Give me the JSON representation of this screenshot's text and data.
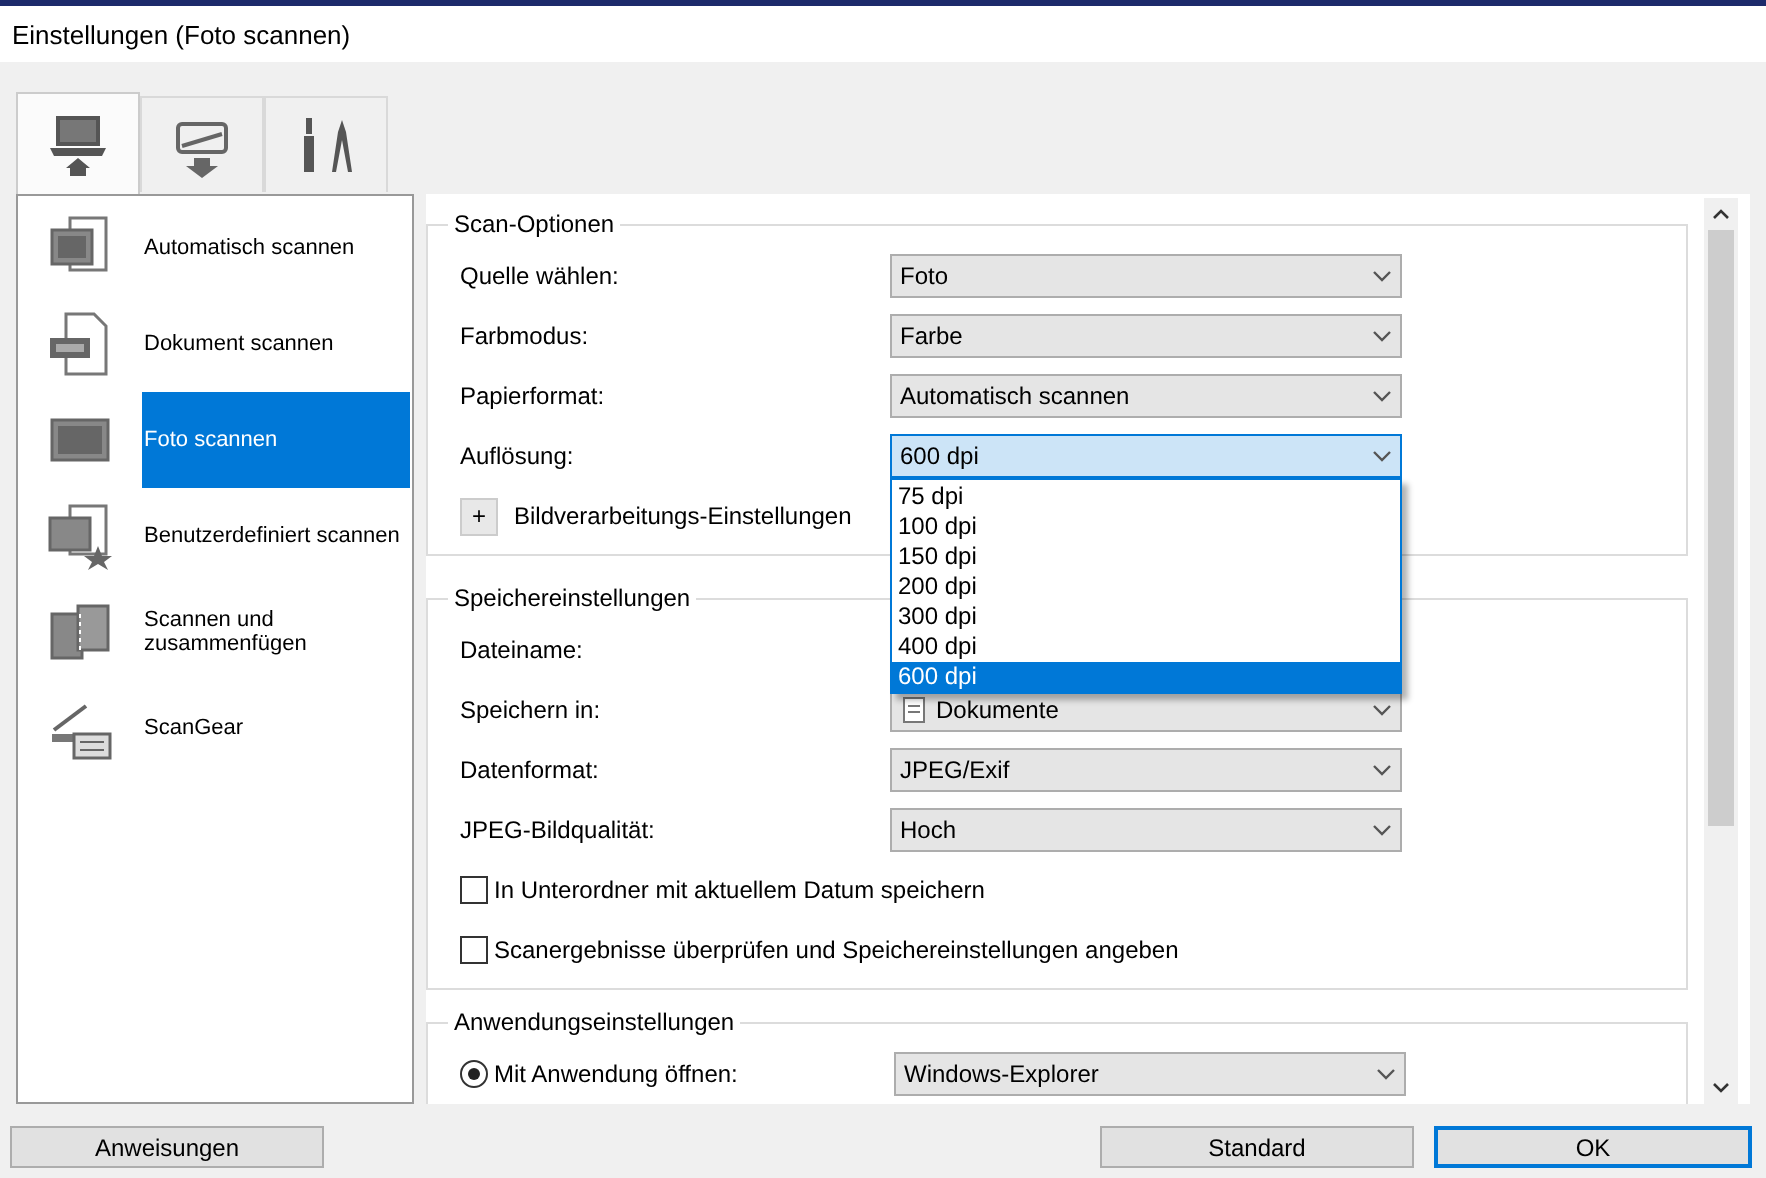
{
  "window": {
    "title": "Einstellungen (Foto scannen)"
  },
  "tabs": [
    {
      "selected": true
    },
    {
      "selected": false
    },
    {
      "selected": false
    }
  ],
  "sidebar": {
    "items": [
      {
        "label": "Automatisch scannen",
        "selected": false
      },
      {
        "label": "Dokument scannen",
        "selected": false
      },
      {
        "label": "Foto scannen",
        "selected": true
      },
      {
        "label": "Benutzerdefiniert scannen",
        "selected": false
      },
      {
        "label": "Scannen und zusammenfügen",
        "selected": false
      },
      {
        "label": "ScanGear",
        "selected": false
      }
    ]
  },
  "scan_options": {
    "title": "Scan-Optionen",
    "fields": [
      {
        "label": "Quelle wählen:",
        "value": "Foto",
        "expanded": false
      },
      {
        "label": "Farbmodus:",
        "value": "Farbe",
        "expanded": false
      },
      {
        "label": "Papierformat:",
        "value": "Automatisch scannen",
        "expanded": false
      },
      {
        "label": "Auflösung:",
        "value": "600 dpi",
        "expanded": true,
        "options": [
          {
            "label": "75 dpi",
            "selected": false
          },
          {
            "label": "100 dpi",
            "selected": false
          },
          {
            "label": "150 dpi",
            "selected": false
          },
          {
            "label": "200 dpi",
            "selected": false
          },
          {
            "label": "300 dpi",
            "selected": false
          },
          {
            "label": "400 dpi",
            "selected": false
          },
          {
            "label": "600 dpi",
            "selected": true
          }
        ]
      }
    ],
    "expander": {
      "symbol": "+",
      "label": "Bildverarbeitungs-Einstellungen"
    }
  },
  "save_settings": {
    "title": "Speichereinstellungen",
    "fields": [
      {
        "label": "Dateiname:",
        "kind": "hidden"
      },
      {
        "label": "Speichern in:",
        "kind": "folder",
        "value": "Dokumente"
      },
      {
        "label": "Datenformat:",
        "kind": "combo",
        "value": "JPEG/Exif"
      },
      {
        "label": "JPEG-Bildqualität:",
        "kind": "combo",
        "value": "Hoch"
      }
    ],
    "checkboxes": [
      {
        "label": "In Unterordner mit aktuellem Datum speichern",
        "checked": false
      },
      {
        "label": "Scanergebnisse überprüfen und Speichereinstellungen angeben",
        "checked": false
      }
    ]
  },
  "app_settings": {
    "title": "Anwendungseinstellungen",
    "options": [
      {
        "label": "Mit Anwendung öffnen:",
        "selected": true,
        "value": "Windows-Explorer"
      }
    ]
  },
  "buttons": [
    {
      "label": "Anweisungen",
      "default": false
    },
    {
      "label": "Standard",
      "default": false
    },
    {
      "label": "OK",
      "default": true
    }
  ]
}
